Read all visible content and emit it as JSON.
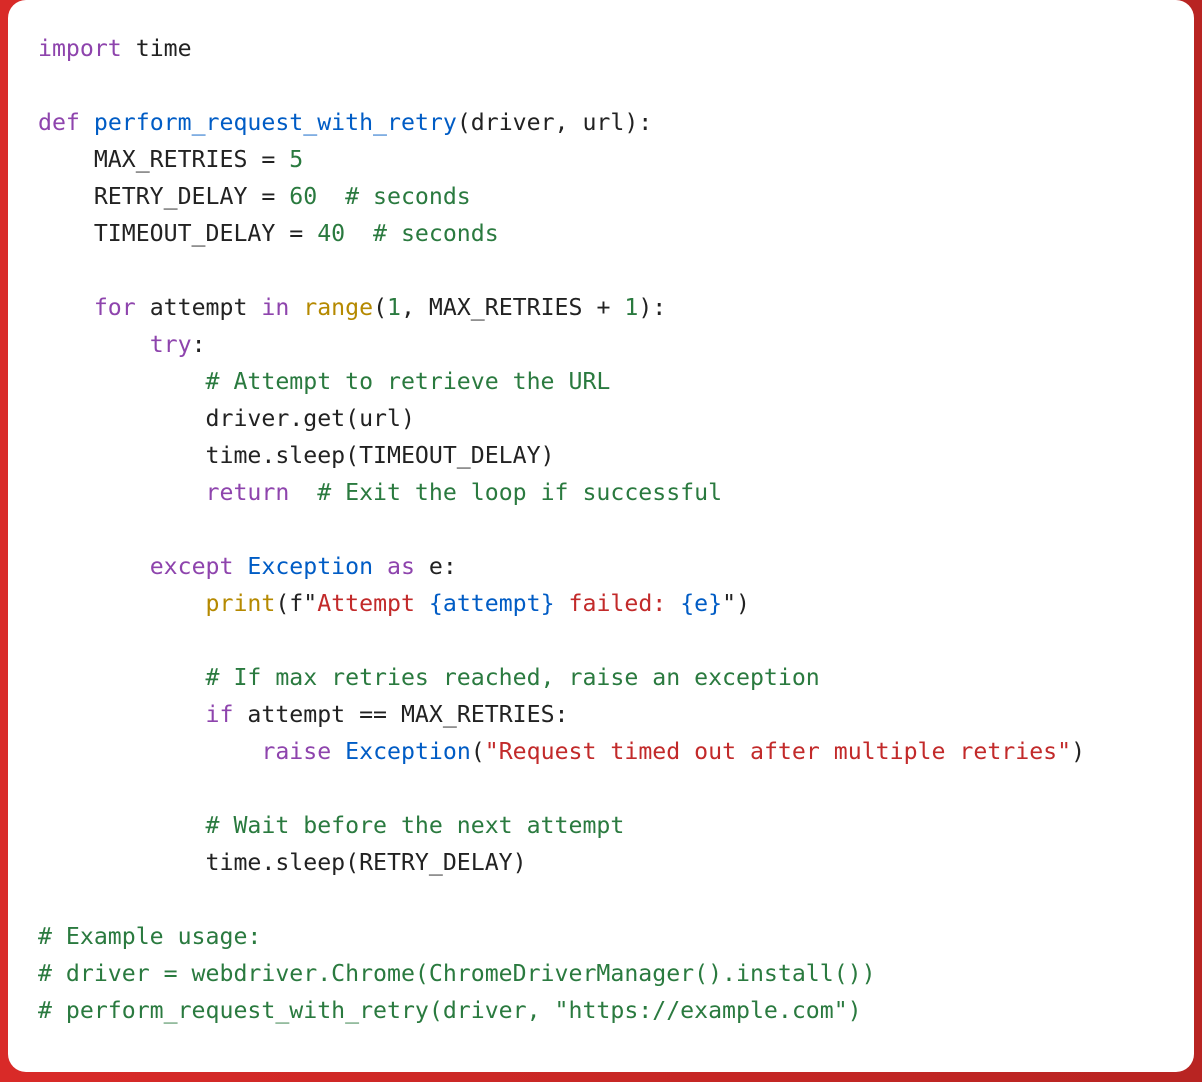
{
  "code": {
    "import_kw": "import",
    "import_mod": "time",
    "def_kw": "def",
    "func_name": "perform_request_with_retry",
    "params": "(driver, url):",
    "max_retries_lhs": "    MAX_RETRIES = ",
    "max_retries_val": "5",
    "retry_delay_lhs": "    RETRY_DELAY = ",
    "retry_delay_val": "60",
    "retry_delay_comment": "  # seconds",
    "timeout_delay_lhs": "    TIMEOUT_DELAY = ",
    "timeout_delay_val": "40",
    "timeout_delay_comment": "  # seconds",
    "for_kw": "for",
    "for_var": " attempt ",
    "in_kw": "in",
    "range_call": " range",
    "range_open": "(",
    "range_one": "1",
    "range_mid": ", MAX_RETRIES + ",
    "range_one2": "1",
    "range_close": "):",
    "try_kw": "try",
    "try_colon": ":",
    "comment_attempt": "            # Attempt to retrieve the URL",
    "driver_get": "            driver.get(url)",
    "time_sleep_timeout": "            time.sleep(TIMEOUT_DELAY)",
    "return_kw": "return",
    "return_comment": "  # Exit the loop if successful",
    "except_kw": "except",
    "exception_cls": "Exception",
    "as_kw": "as",
    "except_tail": " e:",
    "print_call": "print",
    "fstr_open": "(f\"",
    "fstr_part1": "Attempt ",
    "fstr_brace1": "{attempt}",
    "fstr_part2": " failed: ",
    "fstr_brace2": "{e}",
    "fstr_close": "\")",
    "comment_maxretries": "            # If max retries reached, raise an exception",
    "if_kw": "if",
    "if_cond": " attempt == MAX_RETRIES:",
    "raise_kw": "raise",
    "raise_cls": "Exception",
    "raise_open": "(",
    "raise_str": "\"Request timed out after multiple retries\"",
    "raise_close": ")",
    "comment_wait": "            # Wait before the next attempt",
    "time_sleep_retry": "            time.sleep(RETRY_DELAY)",
    "example1": "# Example usage:",
    "example2": "# driver = webdriver.Chrome(ChromeDriverManager().install())",
    "example3": "# perform_request_with_retry(driver, \"https://example.com\")"
  }
}
